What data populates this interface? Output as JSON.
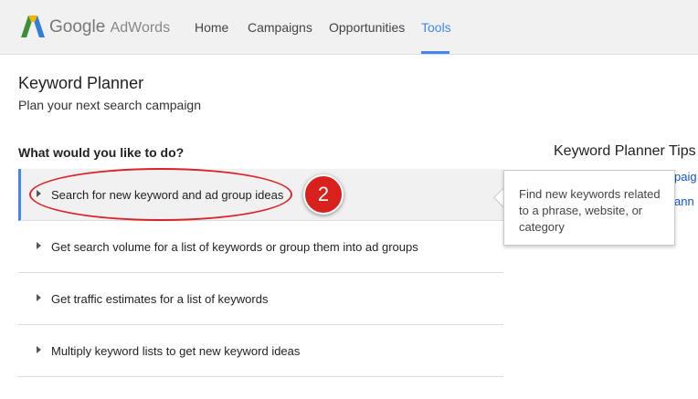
{
  "header": {
    "logo_brand": "Google",
    "logo_product": "AdWords",
    "nav": [
      {
        "label": "Home"
      },
      {
        "label": "Campaigns"
      },
      {
        "label": "Opportunities"
      },
      {
        "label": "Tools",
        "active": true
      }
    ],
    "accent_color": "#4285f4"
  },
  "page": {
    "title": "Keyword Planner",
    "subtitle": "Plan your next search campaign"
  },
  "options_section": {
    "question": "What would you like to do?",
    "options": [
      {
        "label": "Search for new keyword and ad group ideas",
        "selected": true
      },
      {
        "label": "Get search volume for a list of keywords or group them into ad groups"
      },
      {
        "label": "Get traffic estimates for a list of keywords"
      },
      {
        "label": "Multiply keyword lists to get new keyword ideas"
      }
    ]
  },
  "annotation": {
    "step_number": "2",
    "color": "#d8201d"
  },
  "tooltip": {
    "text": "Find new keywords related to a phrase, website, or category"
  },
  "tips_panel": {
    "title": "Keyword Planner Tips",
    "links": [
      "paig",
      "ann"
    ]
  }
}
